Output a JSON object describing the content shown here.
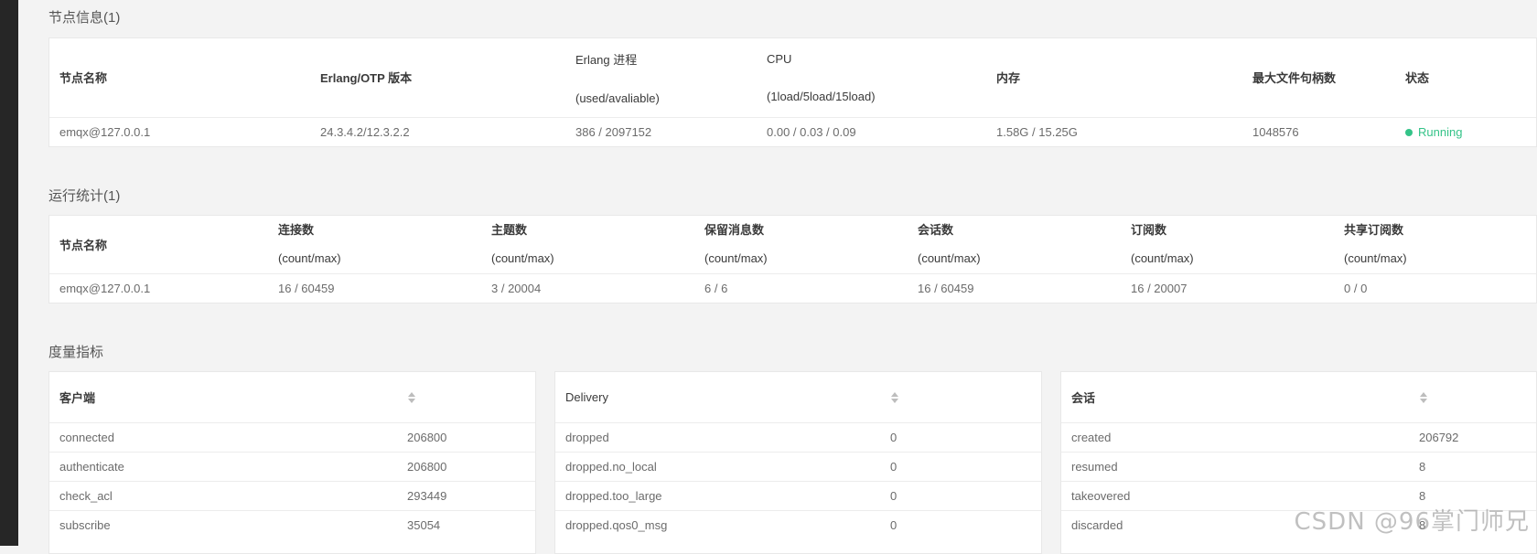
{
  "node_info": {
    "title": "节点信息(1)",
    "headers": {
      "name": "节点名称",
      "otp": "Erlang/OTP 版本",
      "proc": "Erlang 进程",
      "proc_sub": "(used/avaliable)",
      "cpu": "CPU",
      "cpu_sub": "(1load/5load/15load)",
      "mem": "内存",
      "fd": "最大文件句柄数",
      "status": "状态"
    },
    "rows": [
      {
        "name": "emqx@127.0.0.1",
        "otp": "24.3.4.2/12.3.2.2",
        "proc": "386 / 2097152",
        "cpu": "0.00 / 0.03 / 0.09",
        "mem": "1.58G / 15.25G",
        "fd": "1048576",
        "status": "Running"
      }
    ]
  },
  "runtime_stats": {
    "title": "运行统计(1)",
    "headers": {
      "name": "节点名称",
      "connections": "连接数",
      "topics": "主题数",
      "retained": "保留消息数",
      "sessions": "会话数",
      "subscriptions": "订阅数",
      "shared": "共享订阅数",
      "sub": "(count/max)"
    },
    "rows": [
      {
        "name": "emqx@127.0.0.1",
        "connections": "16 / 60459",
        "topics": "3 / 20004",
        "retained": "6 / 6",
        "sessions": "16 / 60459",
        "subscriptions": "16 / 20007",
        "shared": "0 / 0"
      }
    ]
  },
  "metrics": {
    "title": "度量指标",
    "client": {
      "header": "客户端",
      "rows": [
        {
          "k": "connected",
          "v": "206800"
        },
        {
          "k": "authenticate",
          "v": "206800"
        },
        {
          "k": "check_acl",
          "v": "293449"
        },
        {
          "k": "subscribe",
          "v": "35054"
        }
      ]
    },
    "delivery": {
      "header": "Delivery",
      "rows": [
        {
          "k": "dropped",
          "v": "0"
        },
        {
          "k": "dropped.no_local",
          "v": "0"
        },
        {
          "k": "dropped.too_large",
          "v": "0"
        },
        {
          "k": "dropped.qos0_msg",
          "v": "0"
        }
      ]
    },
    "session": {
      "header": "会话",
      "rows": [
        {
          "k": "created",
          "v": "206792"
        },
        {
          "k": "resumed",
          "v": "8"
        },
        {
          "k": "takeovered",
          "v": "8"
        },
        {
          "k": "discarded",
          "v": "8"
        }
      ]
    }
  },
  "watermark": "CSDN @96掌门师兄",
  "colors": {
    "status_running": "#34c388",
    "sidebar": "#262626",
    "background": "#f3f3f3"
  }
}
